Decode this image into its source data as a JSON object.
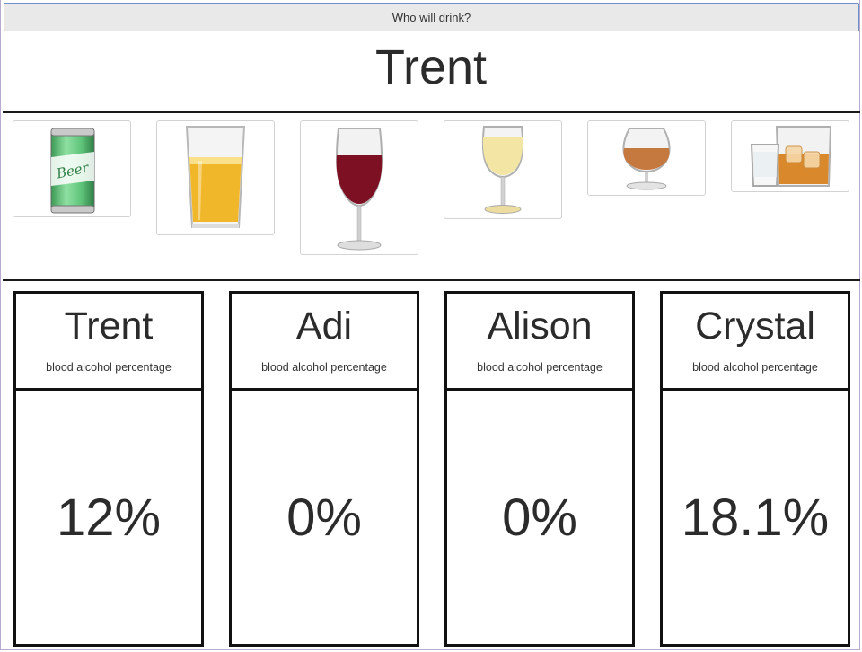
{
  "header": {
    "who_button_label": "Who will drink?",
    "current_drinker": "Trent"
  },
  "drinks": [
    {
      "name": "beer-can",
      "label": "Beer"
    },
    {
      "name": "pint-glass"
    },
    {
      "name": "red-wine-glass"
    },
    {
      "name": "white-wine-glass"
    },
    {
      "name": "brandy-snifter"
    },
    {
      "name": "shot-and-whiskey"
    }
  ],
  "people": [
    {
      "name": "Trent",
      "subtitle": "blood alcohol percentage",
      "value": "12%"
    },
    {
      "name": "Adi",
      "subtitle": "blood alcohol percentage",
      "value": "0%"
    },
    {
      "name": "Alison",
      "subtitle": "blood alcohol percentage",
      "value": "0%"
    },
    {
      "name": "Crystal",
      "subtitle": "blood alcohol percentage",
      "value": "18.1%"
    }
  ],
  "colors": {
    "beer_can": "#5fc47a",
    "beer": "#f1b72a",
    "red_wine": "#7d1023",
    "white_wine": "#f3e6a4",
    "brandy": "#c6793f",
    "whiskey": "#d9892b",
    "card_border": "#111111"
  }
}
